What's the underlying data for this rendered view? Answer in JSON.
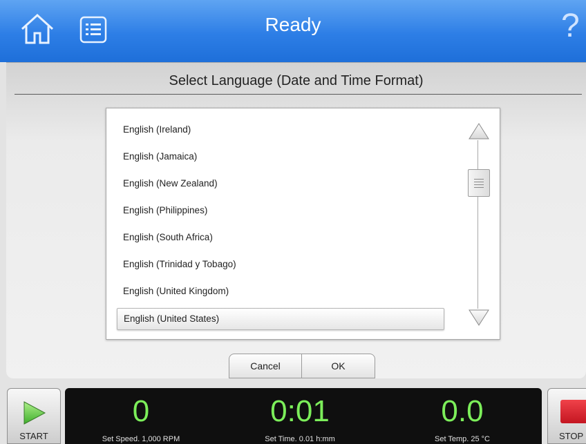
{
  "header": {
    "title": "Ready",
    "home_icon": "home-icon",
    "menu_icon": "list-icon",
    "help_icon": "question-icon",
    "help_glyph": "?",
    "accent_color": "#2d7ee6"
  },
  "dialog": {
    "title": "Select Language (Date and Time Format)",
    "languages": [
      "English (Ireland)",
      "English (Jamaica)",
      "English (New Zealand)",
      "English (Philippines)",
      "English (South Africa)",
      "English (Trinidad y Tobago)",
      "English (United Kingdom)",
      "English (United States)"
    ],
    "selected": "English (United States)",
    "cancel_label": "Cancel",
    "ok_label": "OK"
  },
  "status": {
    "start_label": "START",
    "stop_label": "STOP",
    "speed_value": "0",
    "speed_caption": "Set Speed. 1,000 RPM",
    "time_value": "0:01",
    "time_caption": "Set Time. 0.01 h:mm",
    "temp_value": "0.0",
    "temp_caption": "Set Temp. 25 °C",
    "readout_color": "#7cee5a"
  }
}
